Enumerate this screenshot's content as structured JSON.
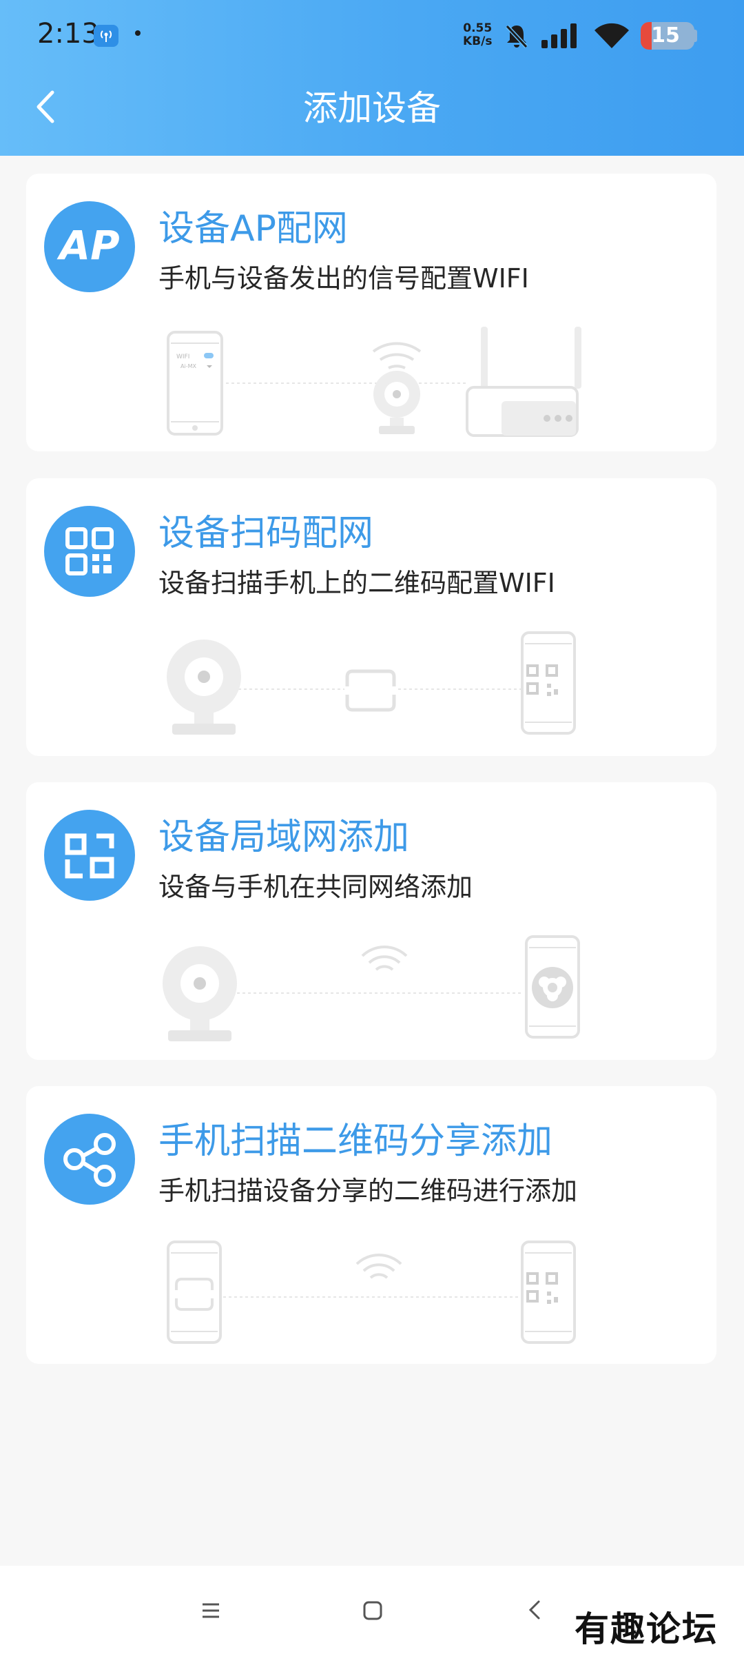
{
  "status_bar": {
    "time": "2:13",
    "network_speed_value": "0.55",
    "network_speed_unit": "KB/s",
    "battery_level": "15",
    "icons": [
      "hotspot-icon",
      "mute-bell-icon",
      "signal-icon",
      "wifi-icon",
      "battery-icon"
    ]
  },
  "header": {
    "title": "添加设备",
    "back_icon": "chevron-left-icon"
  },
  "options": [
    {
      "icon_text": "AP",
      "title": "设备AP配网",
      "description": "手机与设备发出的信号配置WIFI",
      "illustration": {
        "phone_wifi_label": "WIFI",
        "phone_network_label": "Ai-MX"
      }
    },
    {
      "icon": "qr-code-icon",
      "title": "设备扫码配网",
      "description": "设备扫描手机上的二维码配置WIFI"
    },
    {
      "icon": "lan-icon",
      "title": "设备局域网添加",
      "description": "设备与手机在共同网络添加"
    },
    {
      "icon": "share-icon",
      "title": "手机扫描二维码分享添加",
      "description": "手机扫描设备分享的二维码进行添加"
    }
  ],
  "nav_bar": {
    "icons": [
      "menu-icon",
      "home-icon",
      "back-icon"
    ]
  },
  "watermark": "有趣论坛",
  "colors": {
    "accent": "#44a3ef",
    "title_blue": "#3d9ae8",
    "header_gradient_start": "#66bdf9",
    "header_gradient_end": "#3d9df0",
    "illustration_gray": "#e2e2e2",
    "background": "#f7f7f7"
  }
}
